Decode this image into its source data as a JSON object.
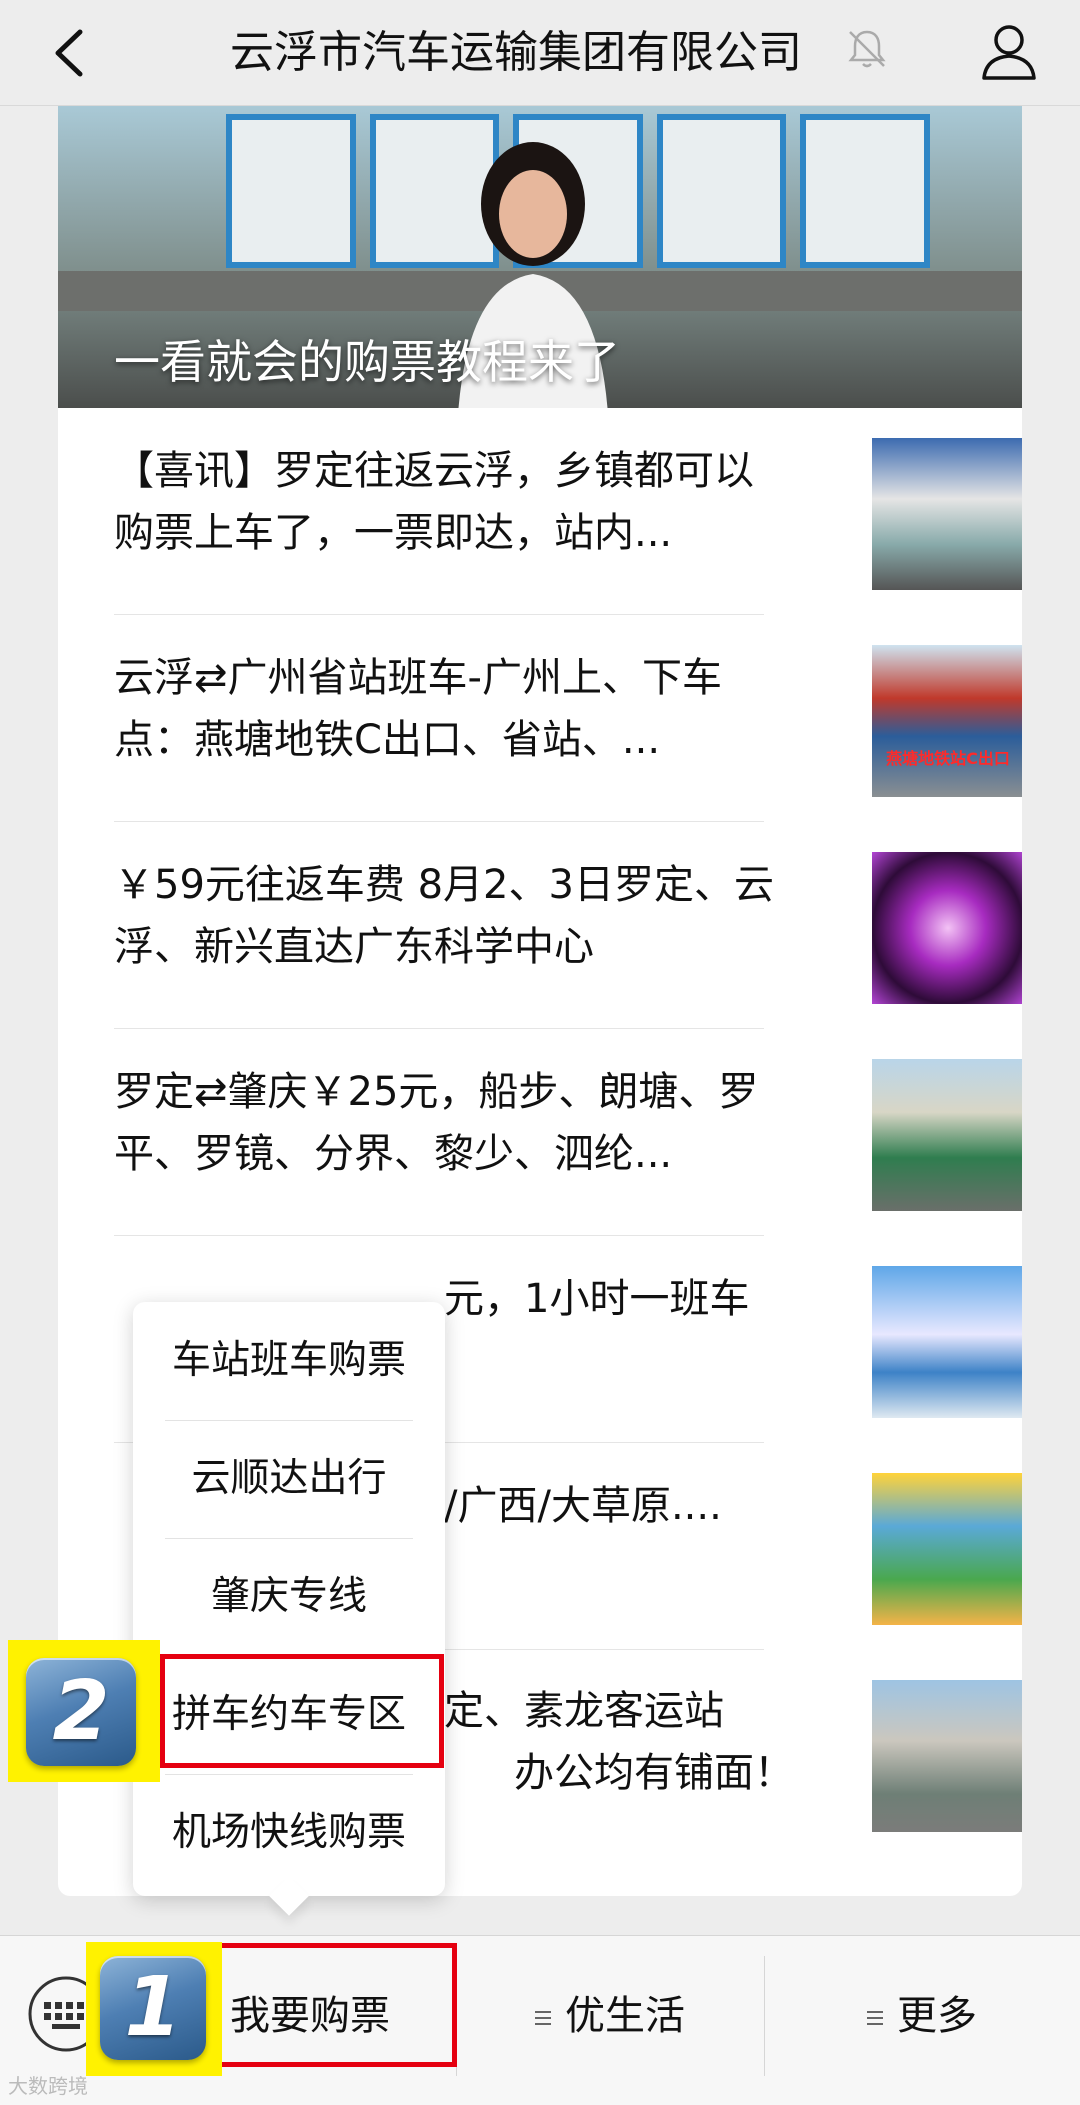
{
  "nav": {
    "title": "云浮市汽车运输集团有限公司",
    "back_icon": "chevron-left-icon",
    "mute_icon": "bell-off-icon",
    "profile_icon": "person-icon"
  },
  "hero": {
    "caption": "一看就会的购票教程来了"
  },
  "articles": [
    {
      "title": "【喜讯】罗定往返云浮，乡镇都可以购票上车了，一票即达，站内..."
    },
    {
      "title": "云浮⇄广州省站班车-广州上、下车点：燕塘地铁C出口、省站、...",
      "thumb_text": "燕塘地铁站C出口"
    },
    {
      "title": "￥59元往返车费 8月2、3日罗定、云浮、新兴直达广东科学中心"
    },
    {
      "title": "罗定⇄肇庆￥25元，船步、朗塘、罗平、罗镜、分界、黎少、泗纶..."
    },
    {
      "title": "罗定往返广州，每天...元，1小时一班车",
      "visible_fragment": "元，1小时一班车"
    },
    {
      "title": "【...】 /广西/大草原....",
      "visible_fragment": "/广西/大草原...."
    },
    {
      "title": "...定、素龙客运站 ...办公均有铺面！",
      "visible_fragment_1": "定、素龙客运站",
      "visible_fragment_2": "办公均有铺面！"
    }
  ],
  "popup_menu": {
    "items": [
      "车站班车购票",
      "云顺达出行",
      "肇庆专线",
      "拼车约车专区",
      "机场快线购票"
    ]
  },
  "bottom_bar": {
    "keyboard_icon": "keyboard-icon",
    "tabs": [
      "我要购票",
      "优生活",
      "更多"
    ]
  },
  "badges": {
    "one": "1",
    "two": "2"
  },
  "watermark": "大数跨境",
  "colors": {
    "highlight_red": "#e50010",
    "badge_yellow": "#fff200"
  }
}
